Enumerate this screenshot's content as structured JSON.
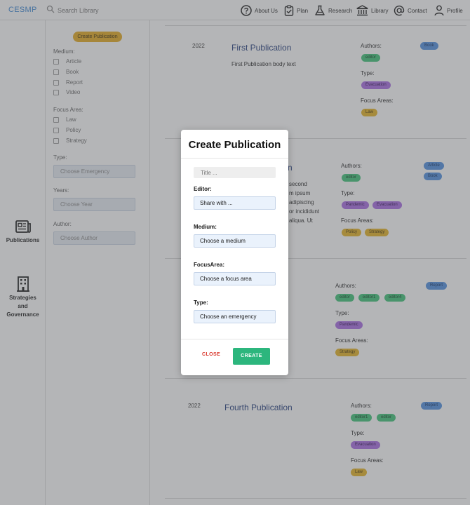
{
  "app": {
    "logo": "CESMP"
  },
  "search": {
    "placeholder": "Search Library"
  },
  "nav": [
    {
      "label": "About Us",
      "icon": "question-circle-icon"
    },
    {
      "label": "Plan",
      "icon": "clipboard-check-icon"
    },
    {
      "label": "Research",
      "icon": "flask-icon"
    },
    {
      "label": "Library",
      "icon": "library-icon"
    },
    {
      "label": "Contact",
      "icon": "at-sign-icon"
    },
    {
      "label": "Profile",
      "icon": "user-icon"
    }
  ],
  "rail": [
    {
      "label": "Publications",
      "icon": "newspaper-icon"
    },
    {
      "label_lines": [
        "Strategies",
        "and",
        "Governance"
      ],
      "icon": "building-icon"
    }
  ],
  "filters": {
    "create_button": "Create Publication",
    "medium_label": "Medium:",
    "medium": [
      "Article",
      "Book",
      "Report",
      "Video"
    ],
    "focus_label": "Focus Area:",
    "focus": [
      "Law",
      "Policy",
      "Strategy"
    ],
    "type_label": "Type:",
    "type_placeholder": "Choose Emergency",
    "years_label": "Years:",
    "years_placeholder": "Choose Year",
    "author_label": "Author:",
    "author_placeholder": "Choose Author"
  },
  "publications": [
    {
      "year": "2022",
      "title": "First Publication",
      "body": "First Publication body text",
      "medium": "Book",
      "authors": [
        "editor"
      ],
      "types": [
        "Evacuation"
      ],
      "focus": [
        "Law"
      ]
    },
    {
      "title_fragment": "n",
      "body_lines": [
        "second",
        "m ipsum",
        "adipiscing",
        "or incididunt",
        "aliqua. Ut"
      ],
      "medium": [
        "Article",
        "Book"
      ],
      "authors": [
        "editor"
      ],
      "types": [
        "Pandemic",
        "Evacuation"
      ],
      "focus": [
        "Policy",
        "Strategy"
      ]
    },
    {
      "medium": "Report",
      "authors": [
        "editor",
        "editor1",
        "editor4"
      ],
      "types": [
        "Pandemic"
      ],
      "focus": [
        "Strategy"
      ]
    },
    {
      "year": "2022",
      "title": "Fourth Publication",
      "medium": "Report",
      "authors": [
        "editor1",
        "editor"
      ],
      "types": [
        "Evacuation"
      ],
      "focus": [
        "Law"
      ]
    }
  ],
  "meta_labels": {
    "authors": "Authors:",
    "type": "Type:",
    "focus": "Focus Areas:"
  },
  "modal": {
    "title": "Create Publication",
    "title_placeholder": "Title ...",
    "editor_label": "Editor:",
    "editor_value": "Share with ...",
    "medium_label": "Medium:",
    "medium_value": "Choose a medium",
    "focus_label": "FocusArea:",
    "focus_value": "Choose a focus area",
    "type_label": "Type:",
    "type_value": "Choose an emergency",
    "close_label": "CLOSE",
    "create_label": "CREATE"
  },
  "colors": {
    "accent": "#3a86d4",
    "create_green": "#2cb67d",
    "close_red": "#d9362b",
    "tag_blue": "#4f8fe0",
    "tag_green": "#3cc477",
    "tag_purple": "#a86be3",
    "tag_yellow": "#e6b322"
  }
}
